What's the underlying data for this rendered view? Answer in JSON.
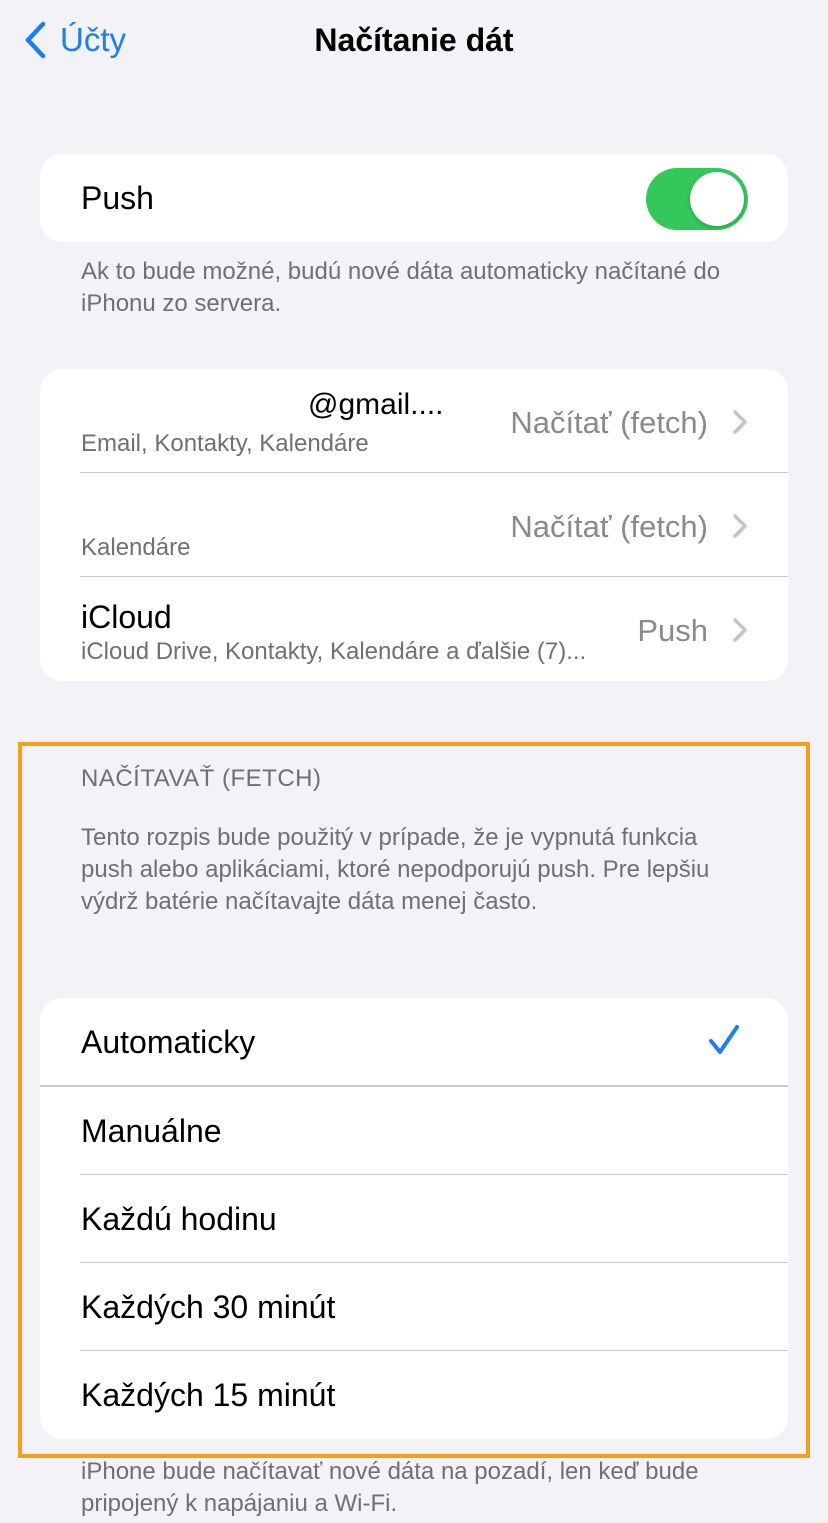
{
  "nav": {
    "back_label": "Účty",
    "title": "Načítanie dát"
  },
  "push": {
    "label": "Push",
    "enabled": true,
    "footnote": "Ak to bude možné, budú nové dáta automaticky načítané do iPhonu zo servera."
  },
  "accounts": [
    {
      "name": "@gmail....",
      "subtitle": "Email, Kontakty, Kalendáre",
      "value": "Načítať (fetch)"
    },
    {
      "name": "",
      "subtitle": "Kalendáre",
      "value": "Načítať (fetch)"
    },
    {
      "name": "iCloud",
      "subtitle": "iCloud Drive, Kontakty, Kalendáre a ďalšie (7)...",
      "value": "Push"
    }
  ],
  "fetch": {
    "header": "NAČÍTAVAŤ (FETCH)",
    "description": "Tento rozpis bude použitý v prípade, že je vypnutá funkcia push alebo aplikáciami, ktoré nepodporujú push. Pre lepšiu výdrž batérie načítavajte dáta menej často.",
    "options": [
      {
        "label": "Automaticky",
        "selected": true
      },
      {
        "label": "Manuálne",
        "selected": false
      },
      {
        "label": "Každú hodinu",
        "selected": false
      },
      {
        "label": "Každých 30 minút",
        "selected": false
      },
      {
        "label": "Každých 15 minút",
        "selected": false
      }
    ],
    "footer": "iPhone bude načítavať nové dáta na pozadí, len keď bude pripojený k napájaniu a Wi-Fi."
  },
  "colors": {
    "accent": "#1a7ef5",
    "toggle_on": "#34c759",
    "highlight": "#f5a01a",
    "background": "#f2f2f7"
  },
  "icons": {
    "back": "chevron-left-icon",
    "disclosure": "chevron-right-icon",
    "selected": "checkmark-icon"
  }
}
